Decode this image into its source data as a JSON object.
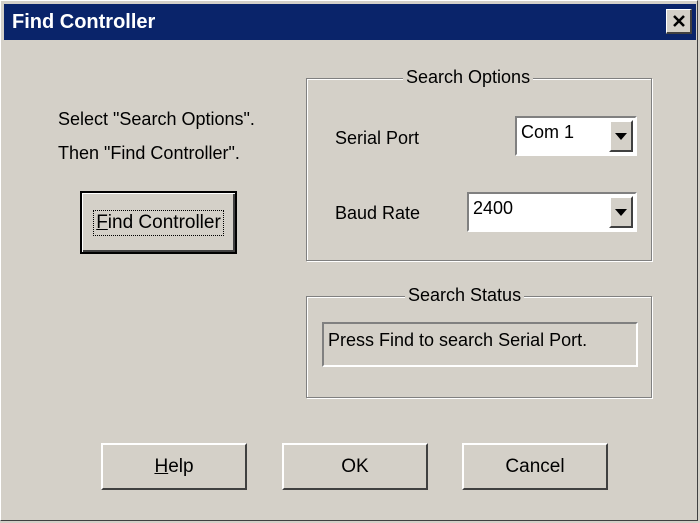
{
  "window": {
    "title": "Find Controller"
  },
  "instructions": {
    "line1": "Select \"Search Options\".",
    "line2": "Then \"Find Controller\"."
  },
  "find_button": {
    "accel": "F",
    "rest": "ind Controller"
  },
  "search_options": {
    "legend": "Search Options",
    "serial_port": {
      "label": "Serial Port",
      "value": "Com 1"
    },
    "baud_rate": {
      "label": "Baud Rate",
      "value": "2400"
    }
  },
  "search_status": {
    "legend": "Search Status",
    "message": "Press Find to search Serial Port."
  },
  "footer": {
    "help": {
      "accel": "H",
      "rest": "elp"
    },
    "ok": "OK",
    "cancel": "Cancel"
  },
  "icons": {
    "close": "close-icon",
    "dropdown": "chevron-down-icon"
  }
}
